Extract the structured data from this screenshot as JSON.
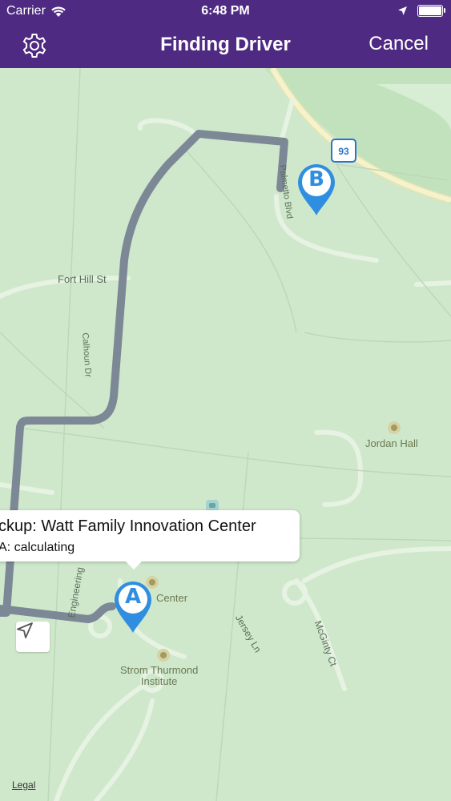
{
  "status_bar": {
    "carrier": "Carrier",
    "time": "6:48 PM"
  },
  "nav": {
    "title": "Finding Driver",
    "cancel_label": "Cancel",
    "settings_icon": "gear-icon"
  },
  "map": {
    "street_labels": [
      "Fort Hill St",
      "Calhoun Dr",
      "Palmetto Blvd",
      "Engineering",
      "Jersey Ln",
      "McGinty Ct"
    ],
    "poi_labels": [
      "Jordan Hall",
      "Center",
      "Strom Thurmond Institute"
    ],
    "poi_label_lines": {
      "strom_line1": "Strom Thurmond",
      "strom_line2": "Institute"
    },
    "route_shield": "93",
    "legal_label": "Legal",
    "colors": {
      "map_background": "#cfe8cc",
      "route": "#7d8896",
      "pin": "#2f8ee0",
      "nav_bar": "#4f2a82"
    }
  },
  "pins": {
    "pickup_letter": "A",
    "destination_letter": "B"
  },
  "callout": {
    "title": "ckup: Watt Family Innovation Center",
    "subtitle": "A: calculating"
  },
  "locate_button_icon": "location-arrow-icon"
}
